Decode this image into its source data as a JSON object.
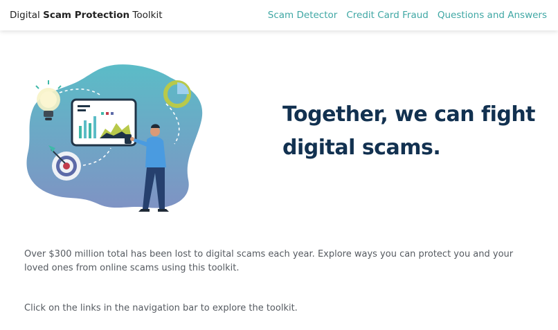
{
  "nav": {
    "brand_pre": "Digital",
    "brand_bold": "Scam Protection",
    "brand_post": "Toolkit",
    "links": [
      "Scam Detector",
      "Credit Card Fraud",
      "Questions and Answers"
    ]
  },
  "hero": {
    "headline": "Together, we can fight digital scams.",
    "illustration_icons": [
      "lightbulb-icon",
      "pie-chart-icon",
      "target-icon",
      "presentation-board-icon",
      "person-figure"
    ]
  },
  "content": {
    "intro": "Over $300 million total has been lost to digital scams each year. Explore ways you can protect you and your loved ones from online scams using this toolkit.",
    "instructions": "Click on the links in the navigation bar to explore the toolkit."
  },
  "colors": {
    "nav_link": "#3fa7a4",
    "headline": "#123150",
    "body_text": "#555a60",
    "blob_top": "#5bbcc7",
    "blob_bottom": "#7f93c4"
  }
}
